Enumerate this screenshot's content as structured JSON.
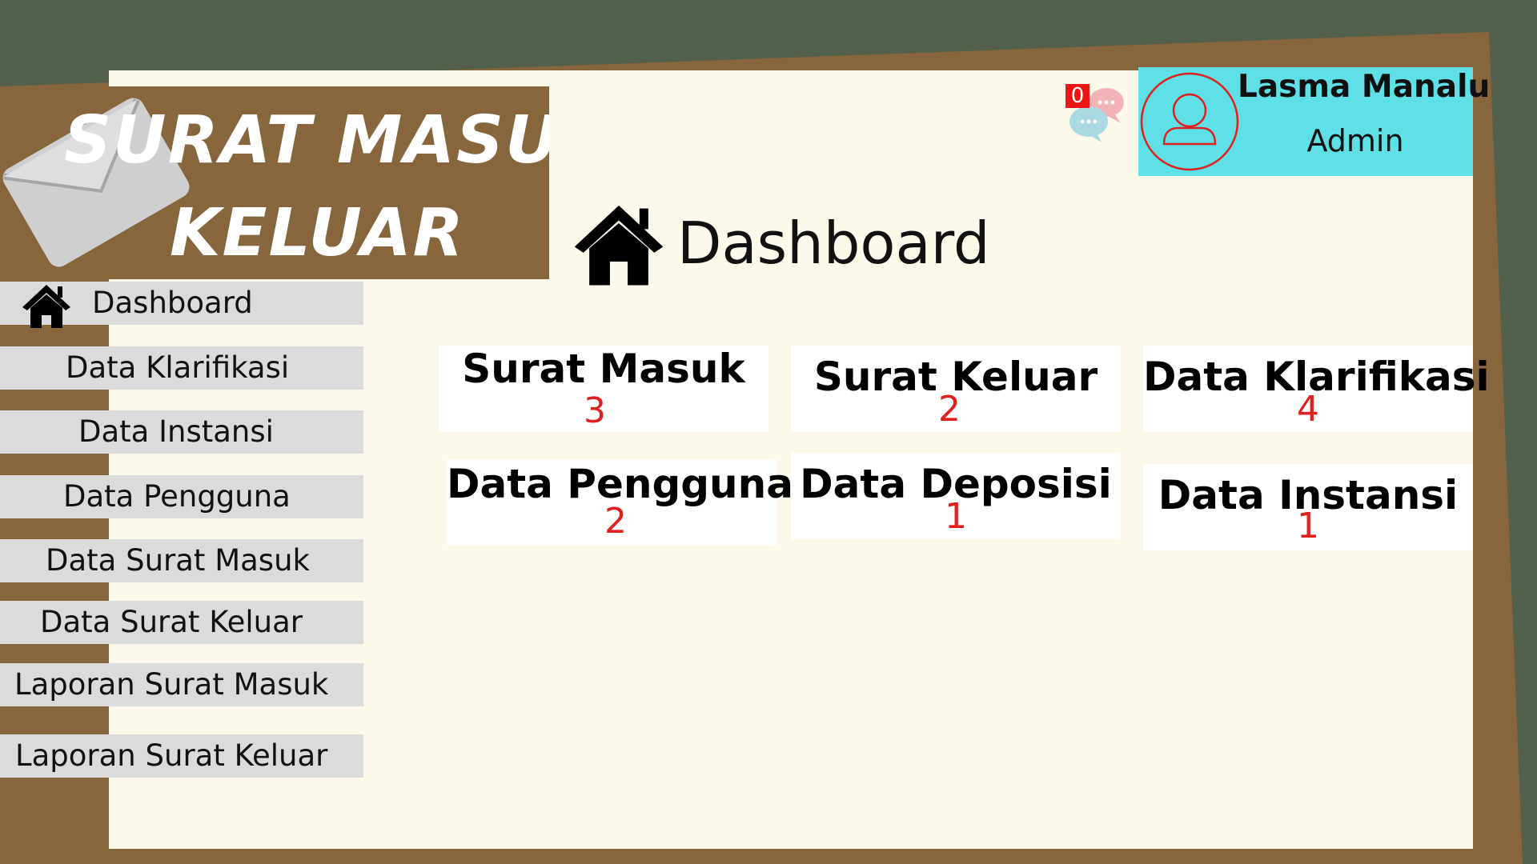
{
  "app": {
    "title_line1": "SURAT MASUK",
    "title_line2": "KELUAR",
    "icon": "envelope-icon"
  },
  "colors": {
    "background": "#53604c",
    "frame": "#87653d",
    "panel": "#fdf9ea",
    "sidebar_item": "#dbdbdb",
    "user_box": "#5ee0e6",
    "accent_red": "#e0201c",
    "badge": "#ee1515"
  },
  "sidebar": {
    "items": [
      {
        "label": "Dashboard",
        "icon": "home-icon"
      },
      {
        "label": "Data Klarifikasi"
      },
      {
        "label": "Data Instansi"
      },
      {
        "label": "Data Pengguna"
      },
      {
        "label": "Data Surat Masuk"
      },
      {
        "label": "Data Surat Keluar"
      },
      {
        "label": "Laporan Surat Masuk"
      },
      {
        "label": "Laporan Surat Keluar"
      }
    ]
  },
  "main": {
    "title": "Dashboard",
    "title_icon": "home-icon",
    "cards": [
      {
        "title": "Surat Masuk",
        "count": "3"
      },
      {
        "title": "Surat Keluar",
        "count": "2"
      },
      {
        "title": "Data Klarifikasi",
        "count": "4"
      },
      {
        "title": "Data Pengguna",
        "count": "2"
      },
      {
        "title": "Data Deposisi",
        "count": "1"
      },
      {
        "title": "Data Instansi",
        "count": "1"
      }
    ]
  },
  "header": {
    "notification_count": "0",
    "notification_icon": "chat-bubbles-icon",
    "user": {
      "name": "Lasma Manalu",
      "role": "Admin",
      "avatar_icon": "user-icon"
    }
  }
}
